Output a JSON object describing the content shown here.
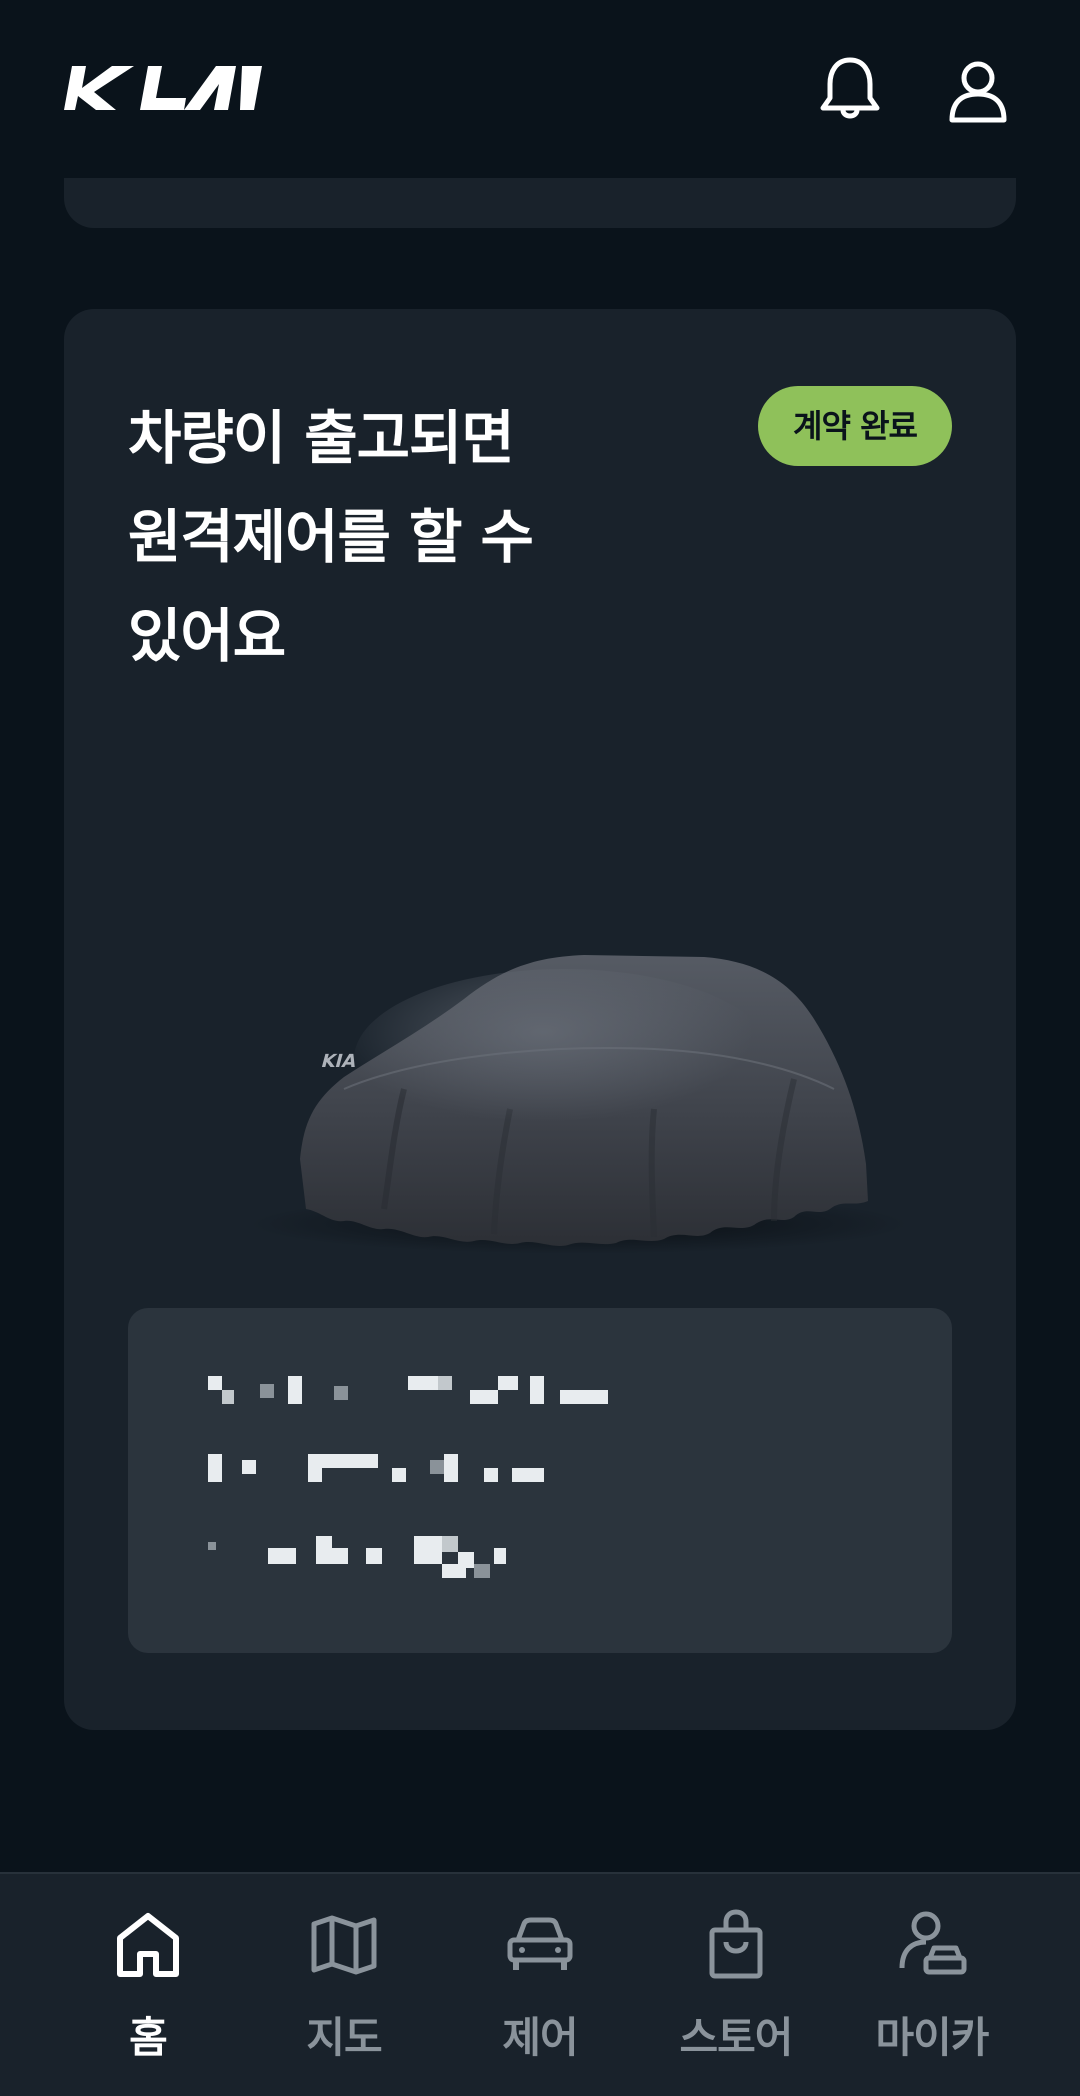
{
  "header": {
    "logo_alt": "KIA",
    "icons": [
      "bell-icon",
      "profile-icon"
    ]
  },
  "card": {
    "title": "차량이 출고되면\n원격제어를 할 수\n있어요",
    "badge": "계약 완료",
    "image": "covered-car"
  },
  "bottom_nav": {
    "items": [
      {
        "label": "홈",
        "icon": "home-icon",
        "active": true
      },
      {
        "label": "지도",
        "icon": "map-icon",
        "active": false
      },
      {
        "label": "제어",
        "icon": "car-icon",
        "active": false
      },
      {
        "label": "스토어",
        "icon": "shopping-bag-icon",
        "active": false
      },
      {
        "label": "마이카",
        "icon": "my-car-icon",
        "active": false
      }
    ]
  },
  "colors": {
    "background": "#0a131b",
    "card": "#19222b",
    "info_box": "#2b343d",
    "badge": "#8fc15a",
    "nav_inactive": "#8a939b",
    "nav_active": "#ffffff"
  }
}
